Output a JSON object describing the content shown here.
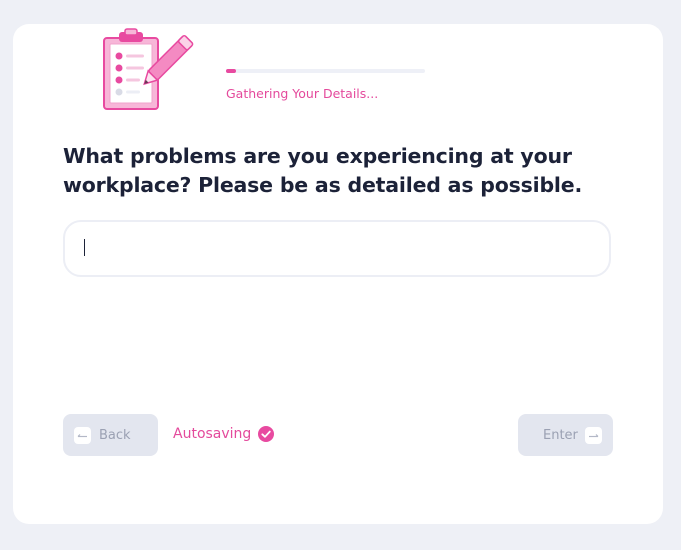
{
  "progress": {
    "fraction": 0.05,
    "label": "Gathering Your Details..."
  },
  "question": {
    "text": "What problems are you experiencing at your workplace? Please be as detailed as possible."
  },
  "answer": {
    "value": "",
    "placeholder": ""
  },
  "footer": {
    "back_label": "Back",
    "autosave_label": "Autosaving",
    "enter_label": "Enter"
  },
  "colors": {
    "accent": "#e84aa0",
    "text": "#1c2238",
    "button_bg": "#e3e6ef",
    "button_text": "#9ba1b3",
    "page_bg": "#eef0f6"
  },
  "icons": {
    "illustration": "clipboard-checklist-pencil-icon",
    "back": "arrow-left-icon",
    "enter": "arrow-right-icon",
    "autosave": "check-circle-icon"
  }
}
